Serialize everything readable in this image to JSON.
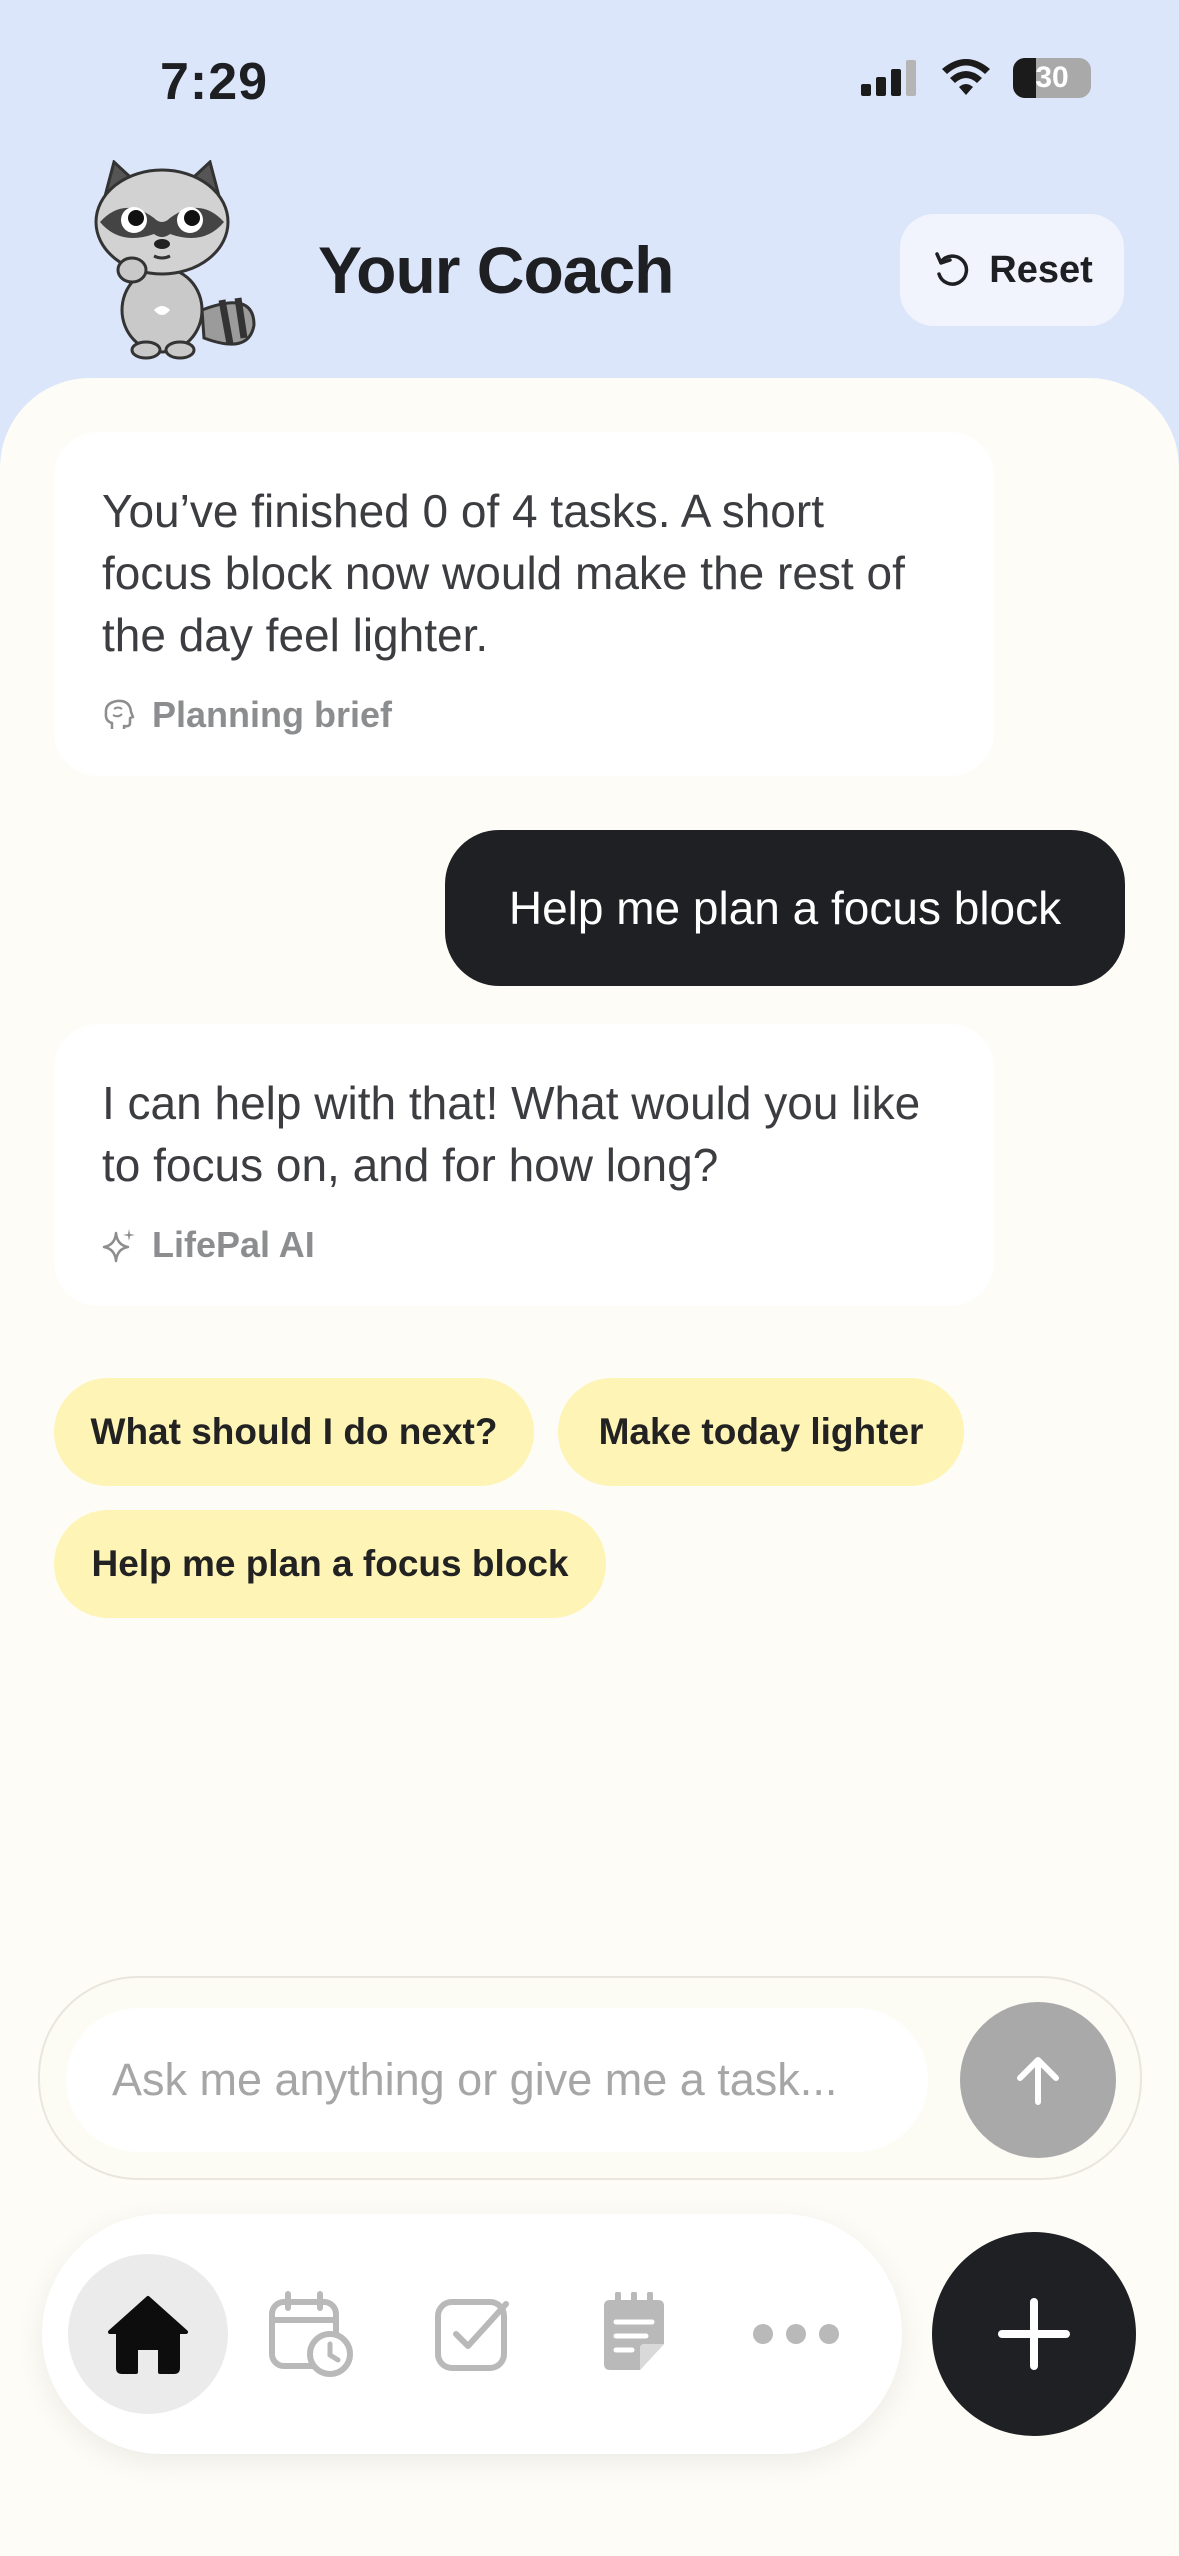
{
  "status_bar": {
    "time": "7:29",
    "battery_level": "30",
    "battery_fraction": 0.3,
    "icons": [
      "cellular-signal-icon",
      "wifi-icon",
      "battery-icon"
    ]
  },
  "header": {
    "title": "Your Coach",
    "reset_label": "Reset",
    "mascot": "raccoon-mascot"
  },
  "messages": [
    {
      "role": "assistant",
      "text": "You’ve finished 0 of 4 tasks. A short focus block now would make the rest of the day feel lighter.",
      "meta_icon": "brain-icon",
      "meta_label": "Planning brief"
    },
    {
      "role": "user",
      "text": "Help me plan a focus block"
    },
    {
      "role": "assistant",
      "text": "I can help with that! What would you like to focus on, and for how long?",
      "meta_icon": "sparkle-icon",
      "meta_label": "LifePal AI"
    }
  ],
  "suggestions": [
    "What should I do next?",
    "Make today lighter",
    "Help me plan a focus block"
  ],
  "composer": {
    "placeholder": "Ask me anything or give me a task..."
  },
  "tabs": [
    {
      "icon": "home-icon",
      "active": true
    },
    {
      "icon": "calendar-clock-icon",
      "active": false
    },
    {
      "icon": "checkbox-icon",
      "active": false
    },
    {
      "icon": "notes-icon",
      "active": false
    },
    {
      "icon": "more-icon",
      "active": false
    }
  ],
  "colors": {
    "header_bg": "#dce6fb",
    "sheet_bg": "#fdfcf6",
    "chip_bg": "#fef4b5",
    "dark": "#1f2023",
    "muted": "#8c8d8f"
  }
}
